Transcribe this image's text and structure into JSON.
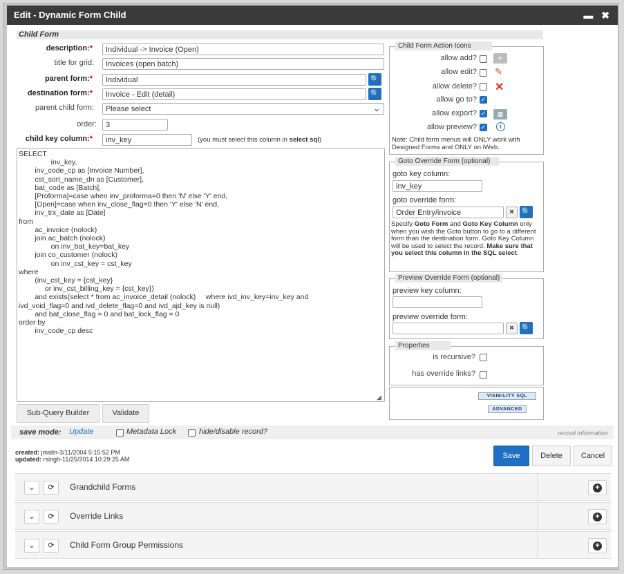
{
  "window": {
    "title": "Edit - Dynamic Form Child",
    "minimize": "▬",
    "close": "✖"
  },
  "section_title": "Child Form",
  "form": {
    "description_label": "description:",
    "description_value": "Individual -> Invoice (Open)",
    "title_label": "title for grid:",
    "title_value": "Invoices (open batch)",
    "parent_form_label": "parent form:",
    "parent_form_value": "Individual",
    "destination_form_label": "destination form:",
    "destination_form_value": "Invoice - Edit (detail)",
    "parent_child_label": "parent child form:",
    "parent_child_value": "Please select",
    "order_label": "order:",
    "order_value": "3",
    "child_key_label": "child key column:",
    "child_key_value": "inv_key",
    "child_key_hint_pre": "(you must select this column in ",
    "child_key_hint_bold": "select sql",
    "child_key_hint_post": ")",
    "sql": "SELECT\n                inv_key,\n        inv_code_cp as [Invoice Number],\n        cst_sort_name_dn as [Customer],\n        bat_code as [Batch],\n        [Proforma]=case when inv_proforma=0 then 'N' else 'Y' end,\n        [Open]=case when inv_close_flag=0 then 'Y' else 'N' end,\n        inv_trx_date as [Date]\nfrom\n        ac_invoice (nolock)\n        join ac_batch (nolock)\n                on inv_bat_key=bat_key\n        join co_customer (nolock)\n                on inv_cst_key = cst_key\nwhere\n        (inv_cst_key = {cst_key}\n             or inv_cst_billing_key = {cst_key})\n        and exists(select * from ac_invoice_detail (nolock)     where ivd_inv_key=inv_key and\nivd_void_flag=0 and ivd_delete_flag=0 and ivd_ajd_key is null)\n        and bat_close_flag = 0 and bat_lock_flag = 0\norder by\n        inv_code_cp desc"
  },
  "buttons": {
    "subquery": "Sub-Query Builder",
    "validate": "Validate",
    "save": "Save",
    "delete": "Delete",
    "cancel": "Cancel",
    "visibility_sql": "VISIBILITY SQL",
    "advanced": "ADVANCED"
  },
  "action_icons": {
    "title": "Child Form Action Icons",
    "allow_add": "allow add?",
    "allow_edit": "allow edit?",
    "allow_delete": "allow delete?",
    "allow_goto": "allow go to?",
    "allow_export": "allow export?",
    "allow_preview": "allow preview?",
    "note": "Note: Child form menus will ONLY work with Designed Forms and ONLY on iWeb."
  },
  "goto_override": {
    "title": "Goto Override Form (optional)",
    "key_label": "goto key column:",
    "key_value": "inv_key",
    "form_label": "goto override form:",
    "form_value": "Order Entry/invoice",
    "help_1": "Specify ",
    "help_b1": "Goto Form",
    "help_2": " and ",
    "help_b2": "Goto Key Column",
    "help_3": " only when you wish the Goto button to go to a different form than the destination form. Goto Key Column will be used to select the record. ",
    "help_b3": "Make sure that you select this column in the SQL select",
    "help_4": "."
  },
  "preview_override": {
    "title": "Preview Override Form (optional)",
    "key_label": "preview key column:",
    "form_label": "preview override form:"
  },
  "properties": {
    "title": "Properties",
    "recursive": "is recursive?",
    "override_links": "has override links?"
  },
  "footer": {
    "save_mode_label": "save mode:",
    "save_mode_value": "Update",
    "metadata_lock": "Metadata Lock",
    "hide_disable": "hide/disable record?",
    "record_info": "record information",
    "created_label": "created:",
    "created_value": " jmalin-3/11/2004 5:15:52 PM",
    "updated_label": "updated:",
    "updated_value": " rsingh-11/25/2014 10:29:25 AM"
  },
  "accordions": [
    "Grandchild Forms",
    "Override Links",
    "Child Form Group Permissions"
  ],
  "colors": {
    "accent": "#1f6fc2",
    "titlebar": "#3a3a3a",
    "delete_red": "#e0301e"
  }
}
